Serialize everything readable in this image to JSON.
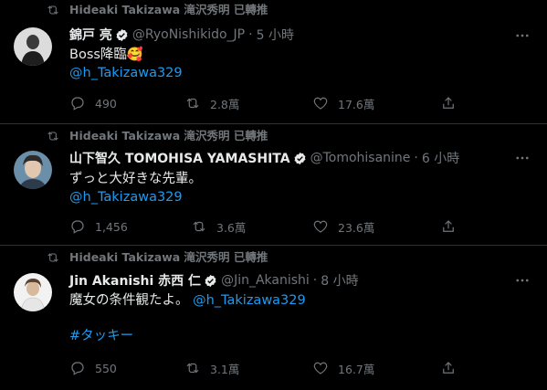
{
  "colors": {
    "background": "#000000",
    "text": "#e7e9ea",
    "muted": "#71767b",
    "link": "#1d9bf0",
    "separator": "#2f3336",
    "verified": "#e7e9ea"
  },
  "tweets": [
    {
      "retweet_label": "Hideaki Takizawa 滝沢秀明 已轉推",
      "name": "錦戸 亮",
      "handle": "@RyoNishikido_JP",
      "time": "5 小時",
      "lines": [
        {
          "text": "Boss降臨🥰",
          "type": "text"
        },
        {
          "text": "@h_Takizawa329",
          "type": "link"
        }
      ],
      "replies": "490",
      "retweets": "2.8萬",
      "likes": "17.6萬"
    },
    {
      "retweet_label": "Hideaki Takizawa 滝沢秀明 已轉推",
      "name": "山下智久 TOMOHISA YAMASHITA",
      "handle": "@Tomohisanine",
      "time": "6 小時",
      "lines": [
        {
          "text": "ずっと大好きな先輩。",
          "type": "text"
        },
        {
          "text": "@h_Takizawa329",
          "type": "link"
        }
      ],
      "replies": "1,456",
      "retweets": "3.6萬",
      "likes": "23.6萬"
    },
    {
      "retweet_label": "Hideaki Takizawa 滝沢秀明 已轉推",
      "name": "Jin Akanishi 赤西 仁",
      "handle": "@Jin_Akanishi",
      "time": "8 小時",
      "line1_text": "魔女の条件観たよ。",
      "line1_link": "@h_Takizawa329",
      "hashtag": "#タッキー",
      "replies": "550",
      "retweets": "3.1萬",
      "likes": "16.7萬"
    }
  ],
  "icons": [
    "retweet-icon",
    "verified-badge-icon",
    "more-icon",
    "reply-icon",
    "like-icon",
    "share-icon"
  ]
}
